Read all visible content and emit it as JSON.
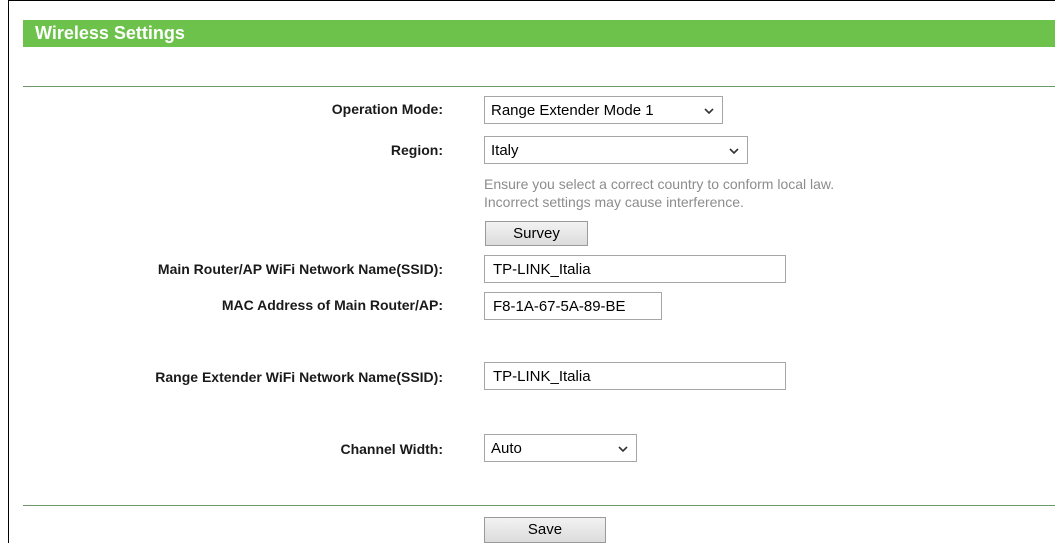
{
  "page": {
    "title": "Wireless Settings"
  },
  "form": {
    "operation_mode": {
      "label": "Operation Mode:",
      "value": "Range Extender Mode 1"
    },
    "region": {
      "label": "Region:",
      "value": "Italy",
      "note_line1": "Ensure you select a correct country to conform local law.",
      "note_line2": "Incorrect settings may cause interference."
    },
    "survey_button": "Survey",
    "main_ssid": {
      "label": "Main Router/AP WiFi Network Name(SSID):",
      "value": "TP-LINK_Italia"
    },
    "main_mac": {
      "label": "MAC Address of Main Router/AP:",
      "value": "F8-1A-67-5A-89-BE"
    },
    "extender_ssid": {
      "label": "Range Extender WiFi Network Name(SSID):",
      "value": "TP-LINK_Italia"
    },
    "channel_width": {
      "label": "Channel Width:",
      "value": "Auto"
    },
    "save_button": "Save"
  },
  "icons": {
    "dropdown": "chevron-down-icon"
  },
  "colors": {
    "title_bar": "#6cc24a",
    "divider": "#6a9a6a",
    "note_text": "#8c8c8c"
  }
}
